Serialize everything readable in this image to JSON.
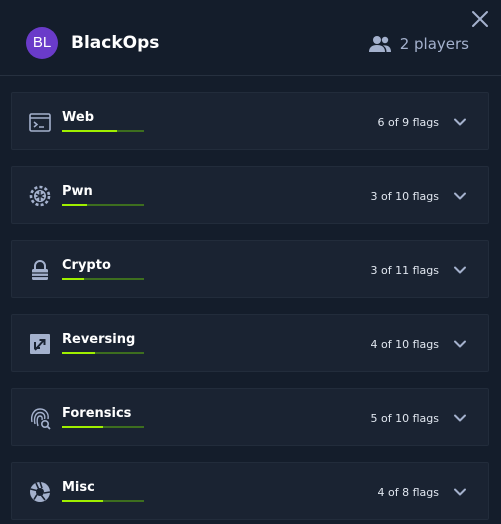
{
  "team": {
    "initials": "BL",
    "name": "BlackOps",
    "players_label": "2 players",
    "avatar_color": "#6a3bc9"
  },
  "colors": {
    "background": "#141d2b",
    "card": "#1a2332",
    "progress_fill": "#9fef00",
    "progress_track": "#3d6e1f",
    "muted_text": "#a4b1cd"
  },
  "categories": [
    {
      "name": "Web",
      "icon": "terminal-window-icon",
      "flags_label": "6 of 9 flags",
      "progress": 0.667
    },
    {
      "name": "Pwn",
      "icon": "gear-bug-icon",
      "flags_label": "3 of 10 flags",
      "progress": 0.3
    },
    {
      "name": "Crypto",
      "icon": "lock-icon",
      "flags_label": "3 of 11 flags",
      "progress": 0.273
    },
    {
      "name": "Reversing",
      "icon": "reverse-arrows-icon",
      "flags_label": "4 of 10 flags",
      "progress": 0.4
    },
    {
      "name": "Forensics",
      "icon": "fingerprint-search-icon",
      "flags_label": "5 of 10 flags",
      "progress": 0.5
    },
    {
      "name": "Misc",
      "icon": "aperture-icon",
      "flags_label": "4 of 8 flags",
      "progress": 0.5
    }
  ]
}
